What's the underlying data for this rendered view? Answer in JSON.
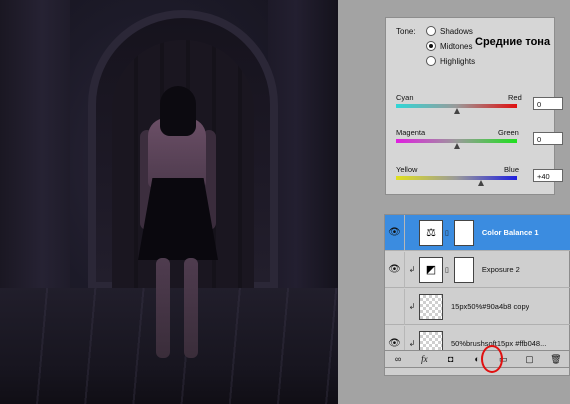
{
  "color_balance": {
    "tone_label": "Tone:",
    "tone_options": [
      {
        "label": "Shadows",
        "selected": false
      },
      {
        "label": "Midtones",
        "selected": true
      },
      {
        "label": "Highlights",
        "selected": false
      }
    ],
    "annotation": "Средние тона",
    "sliders": [
      {
        "left": "Cyan",
        "right": "Red",
        "value": "0",
        "level": 0.5,
        "gradient": [
          "#2fd6d6",
          "#e01010"
        ]
      },
      {
        "left": "Magenta",
        "right": "Green",
        "value": "0",
        "level": 0.5,
        "gradient": [
          "#e01fe0",
          "#1fe01f"
        ]
      },
      {
        "left": "Yellow",
        "right": "Blue",
        "value": "+40",
        "level": 0.7,
        "gradient": [
          "#e0e01f",
          "#1f1fe0"
        ]
      }
    ]
  },
  "layers": {
    "items": [
      {
        "name": "Color Balance 1",
        "selected": true,
        "thumb": "scale-icon",
        "has_mask": true
      },
      {
        "name": "Exposure 2",
        "selected": false,
        "thumb": "exposure-icon",
        "has_mask": true
      },
      {
        "name": "15px50%#90a4b8 copy",
        "selected": false,
        "thumb": "transparent",
        "has_mask": false
      },
      {
        "name": "50%brushsoft15px #ffb048...",
        "selected": false,
        "thumb": "transparent",
        "has_mask": false
      }
    ],
    "toolbar_icons": [
      "link-icon",
      "fx-icon",
      "mask-icon",
      "adjustment-icon",
      "folder-icon",
      "new-layer-icon",
      "trash-icon"
    ],
    "toolbar_glyphs": [
      "∞",
      "fx",
      "◘",
      "◐",
      "▭",
      "▢",
      "🗑"
    ]
  },
  "colors": {
    "selection": "#3b8ce0",
    "annotation_ring": "#e01010"
  }
}
